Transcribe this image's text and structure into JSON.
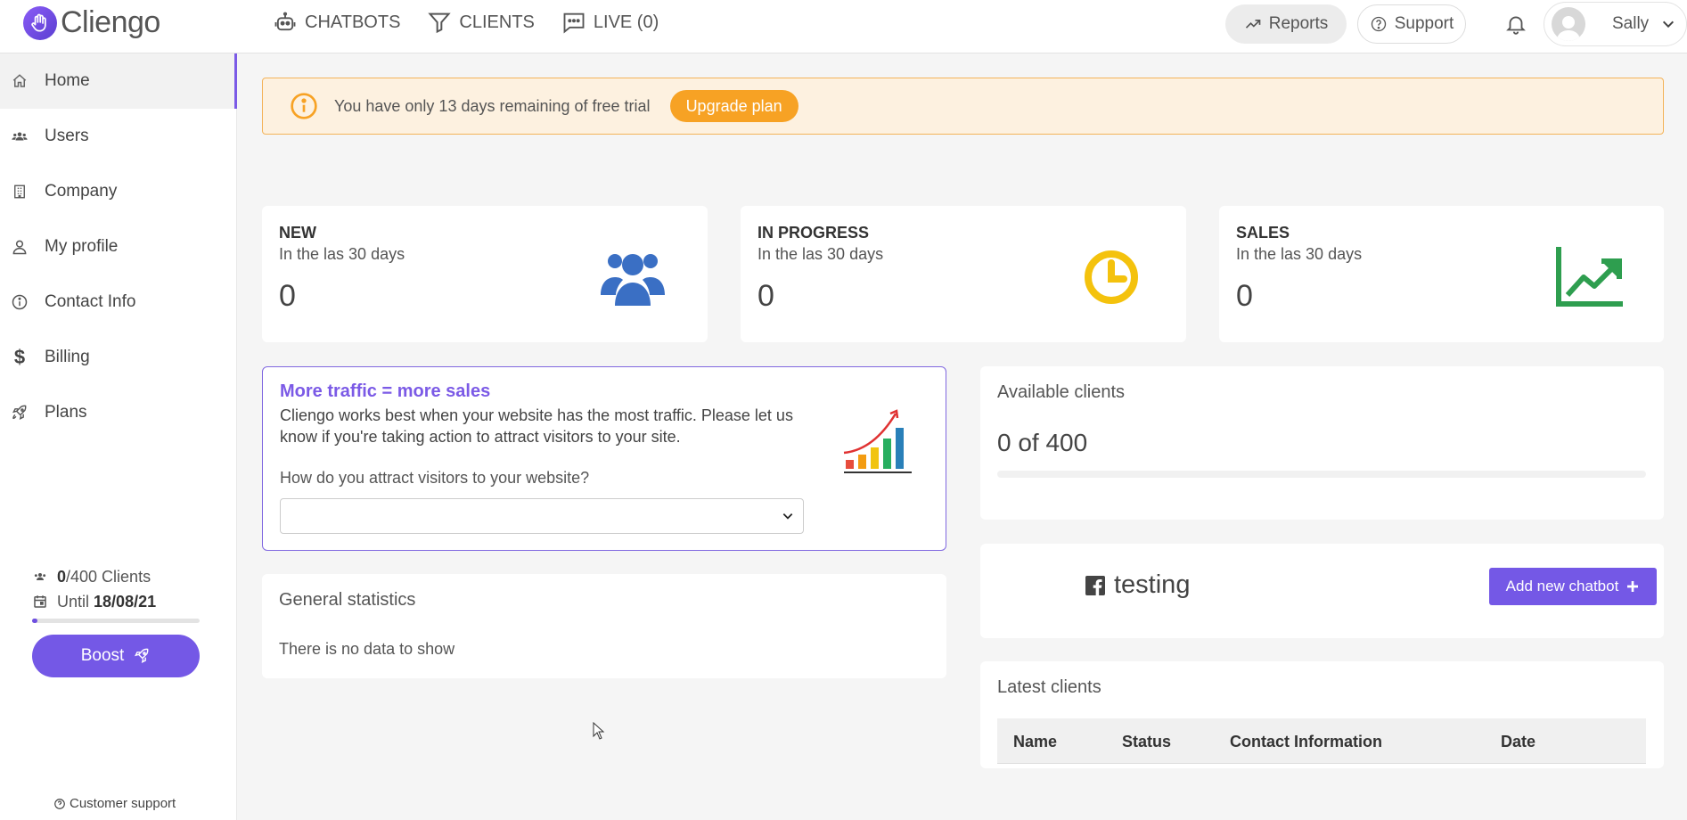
{
  "app": {
    "logo_text": "Cliengo"
  },
  "nav": {
    "tabs": [
      {
        "label": "CHATBOTS"
      },
      {
        "label": "CLIENTS"
      },
      {
        "label": "LIVE (0)"
      }
    ],
    "reports_label": "Reports",
    "support_label": "Support",
    "user_name": "Sally"
  },
  "sidebar": {
    "items": [
      {
        "label": "Home",
        "icon": "home-icon"
      },
      {
        "label": "Users",
        "icon": "users-icon"
      },
      {
        "label": "Company",
        "icon": "building-icon"
      },
      {
        "label": "My profile",
        "icon": "person-icon"
      },
      {
        "label": "Contact Info",
        "icon": "info-icon"
      },
      {
        "label": "Billing",
        "icon": "dollar-icon"
      },
      {
        "label": "Plans",
        "icon": "rocket-icon"
      }
    ],
    "clients_used": "0",
    "clients_total": "/400 Clients",
    "until_label": "Until",
    "until_date": "18/08/21",
    "progress_fraction": 0.0,
    "boost_label": "Boost",
    "customer_support_label": "Customer support"
  },
  "banner": {
    "text": "You have only 13 days remaining of free trial",
    "upgrade_label": "Upgrade plan"
  },
  "stats": [
    {
      "title": "NEW",
      "subtitle": "In the las 30 days",
      "value": "0",
      "icon": "users-group-icon",
      "color": "#3a6fc4"
    },
    {
      "title": "IN PROGRESS",
      "subtitle": "In the las 30 days",
      "value": "0",
      "icon": "clock-icon",
      "color": "#f4c20d"
    },
    {
      "title": "SALES",
      "subtitle": "In the las 30 days",
      "value": "0",
      "icon": "trend-up-icon",
      "color": "#2e9e4f"
    }
  ],
  "traffic": {
    "title": "More traffic = more sales",
    "description": "Cliengo works best when your website has the most traffic. Please let us know if you're taking action to attract visitors to your site.",
    "question": "How do you attract visitors to your website?",
    "selected": ""
  },
  "available": {
    "title": "Available clients",
    "value": "0 of 400",
    "fraction": 0.0
  },
  "chatbot": {
    "name": "testing",
    "add_label": "Add new chatbot"
  },
  "general_stats": {
    "title": "General statistics",
    "empty_text": "There is no data to show"
  },
  "latest_clients": {
    "title": "Latest clients",
    "columns": [
      "Name",
      "Status",
      "Contact Information",
      "Date"
    ]
  },
  "colors": {
    "accent": "#7458e6",
    "warning": "#f7a224",
    "banner_bg": "#fdf1e0"
  }
}
